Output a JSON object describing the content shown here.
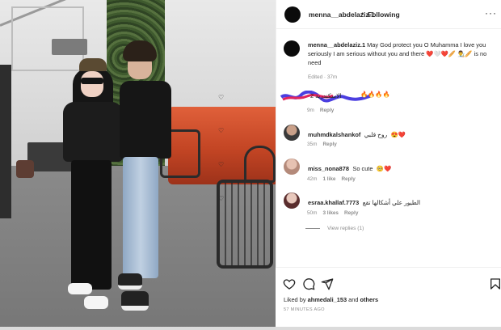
{
  "header": {
    "username": "menna__abdelaziz.1",
    "separator": "•",
    "follow_state": "Following",
    "more": "···"
  },
  "caption": {
    "username": "menna__abdelaziz.1",
    "text": "May God protect you O Muhamma I love you seriously I am serious without you and there",
    "emoji_line_1": "❤️🤍❤️🥖",
    "emoji_line_2": "👨‍🎨🥖",
    "tail": "is no need",
    "edited": "Edited",
    "dot": "·",
    "age": "37m"
  },
  "comments": [
    {
      "username": "",
      "text": "الاسكندريه 2",
      "emoji": "🔥🔥🔥🔥",
      "age": "9m",
      "likes": "",
      "reply": "Reply",
      "avatar": "red-scribble"
    },
    {
      "username": "muhmdkalshankof",
      "text": "روح قلبي",
      "emoji": "😍❤️",
      "age": "35m",
      "likes": "",
      "reply": "Reply",
      "avatar": "man-photo"
    },
    {
      "username": "miss_nona878",
      "text": "So cute",
      "emoji": "🥺❤️",
      "age": "42m",
      "likes": "1 like",
      "reply": "Reply",
      "avatar": "woman-photo"
    },
    {
      "username": "esraa.khallaf.7773",
      "text": "الطيور علي أشكالها تقع",
      "emoji": "",
      "age": "50m",
      "likes": "3 likes",
      "reply": "Reply",
      "avatar": "woman-photo-2"
    }
  ],
  "view_replies": "View replies (1)",
  "footer": {
    "liked_by_prefix": "Liked by",
    "liked_by_user": "ahmedali_153",
    "liked_by_and": "and",
    "liked_by_others": "others",
    "time": "57 MINUTES AGO"
  },
  "icons": {
    "like": "heart-icon",
    "comment": "comment-icon",
    "share": "share-icon",
    "save": "bookmark-icon",
    "comment_like": "heart-icon"
  },
  "colors": {
    "text": "#262626",
    "muted": "#8e8e8e",
    "border": "#efefef",
    "scribble": "#4b3ee0"
  }
}
